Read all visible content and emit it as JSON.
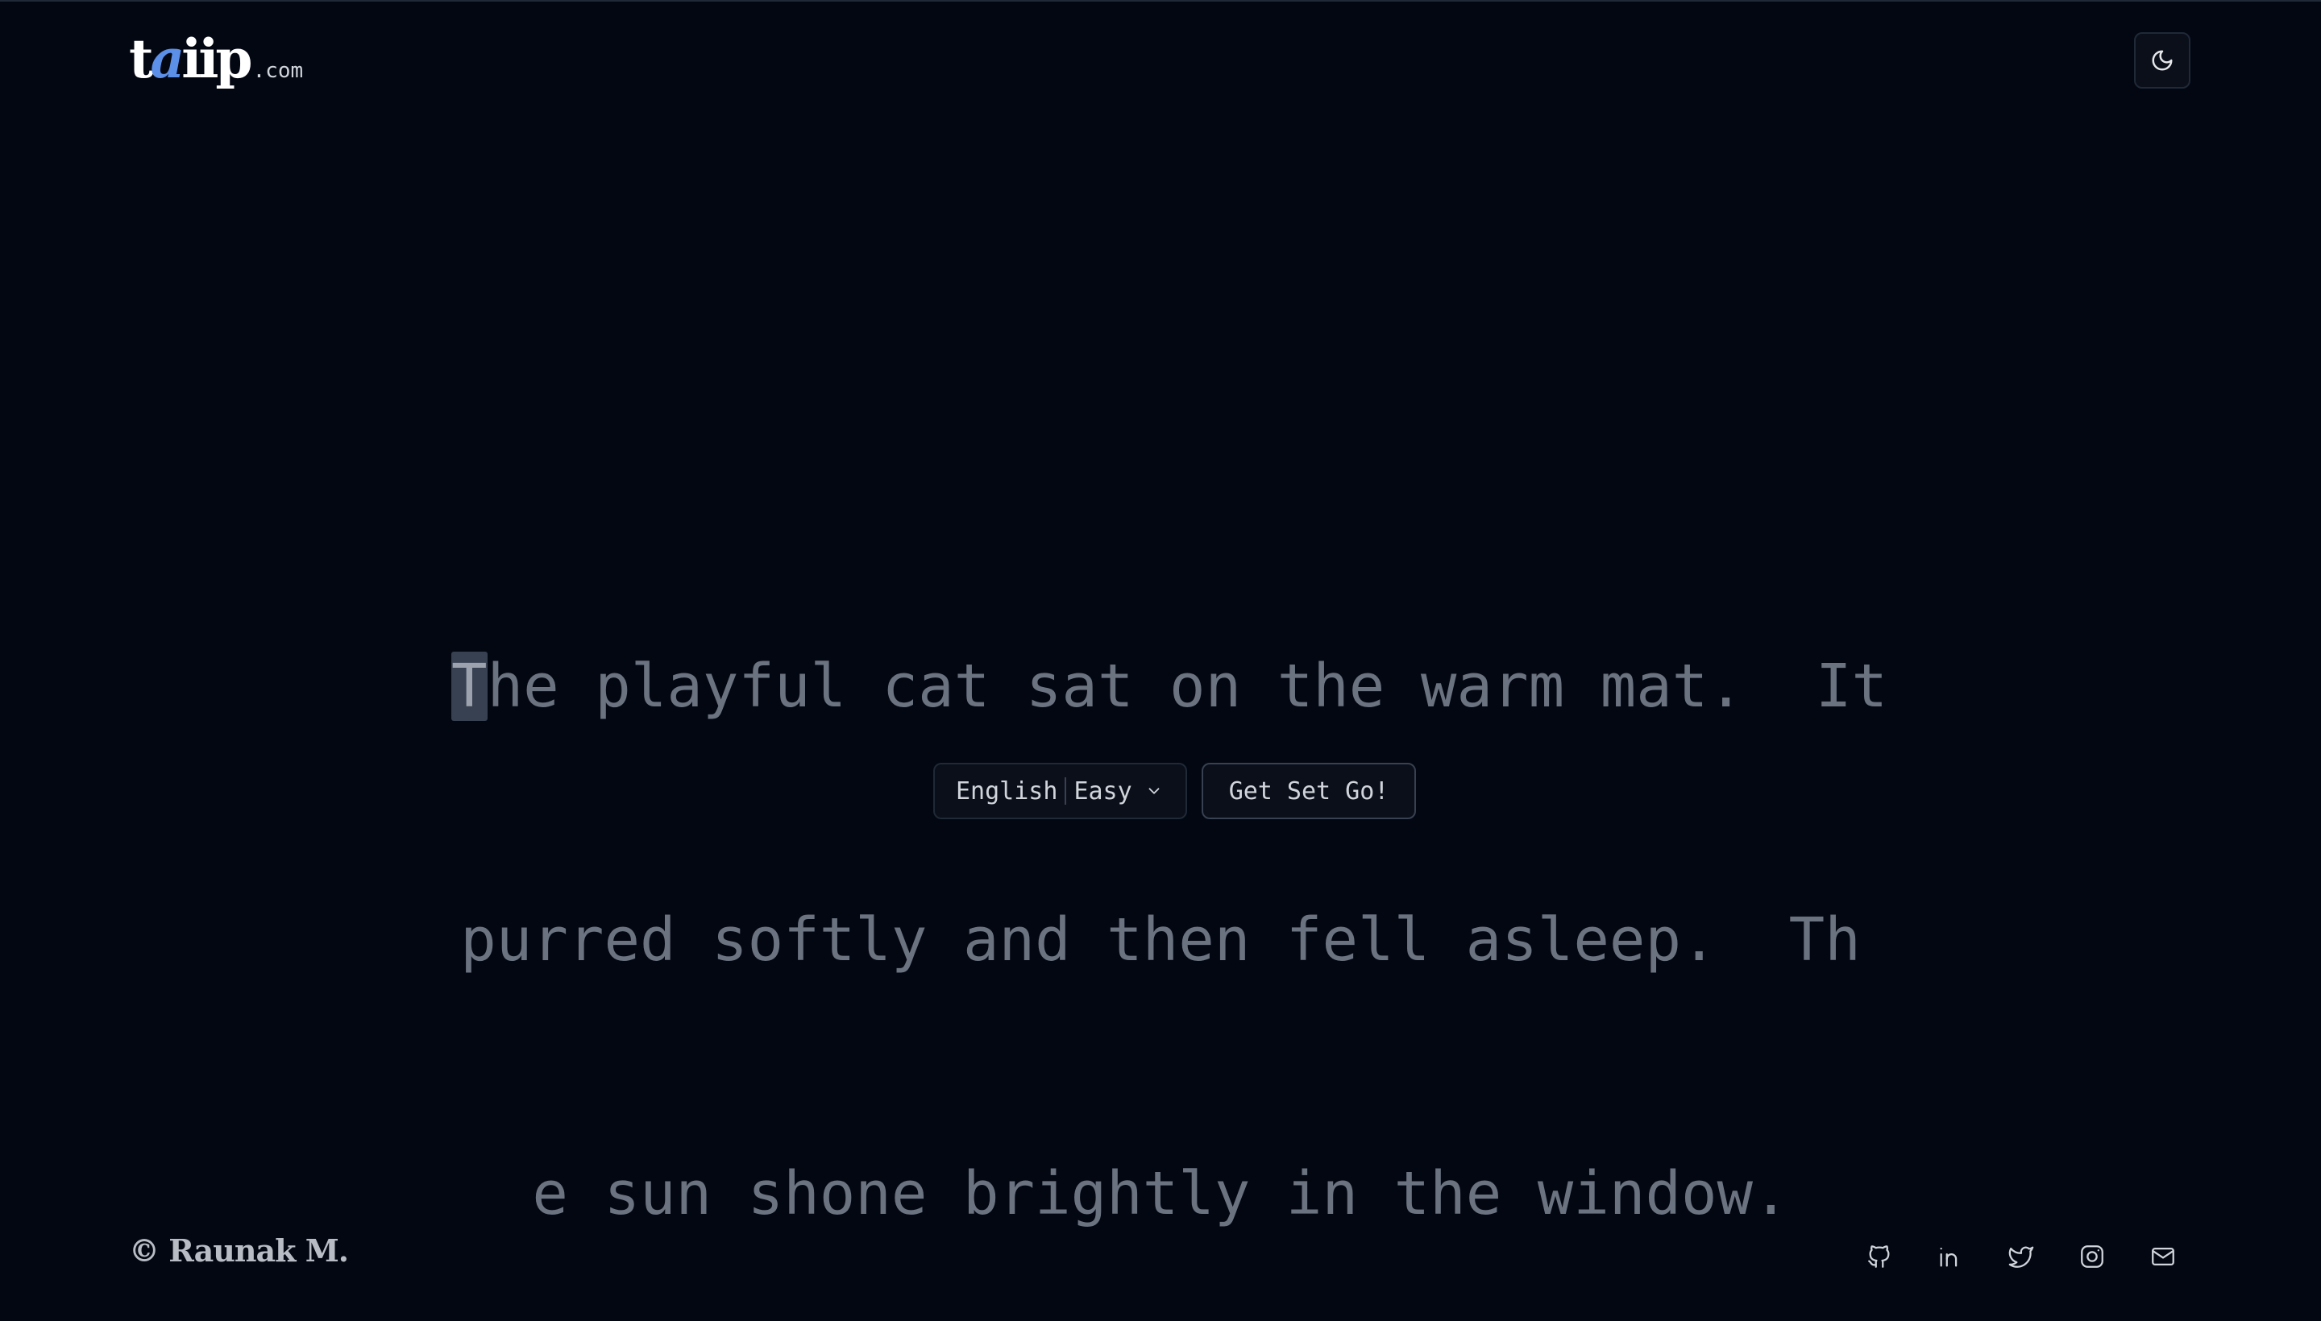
{
  "header": {
    "logo_main_prefix": "t",
    "logo_main_accent": "a",
    "logo_main_rest": "iip",
    "logo_suffix": ".com",
    "theme_toggle_icon": "moon-icon"
  },
  "passage": {
    "current_char": "T",
    "lines": [
      "he playful cat sat on the warm mat.  It",
      "purred softly and then fell asleep.  Th",
      "e sun shone brightly in the window."
    ]
  },
  "controls": {
    "language": "English",
    "difficulty": "Easy",
    "dropdown_icon": "chevron-down-icon",
    "start_label": "Get Set Go!"
  },
  "footer": {
    "copyright": "© Raunak M.",
    "social_icons": [
      "github-icon",
      "linkedin-icon",
      "twitter-icon",
      "instagram-icon",
      "mail-icon"
    ]
  },
  "colors": {
    "background": "#030712",
    "accent": "#5b8fe8",
    "untyped_text": "#6b7280",
    "caret_bg": "#374151"
  }
}
